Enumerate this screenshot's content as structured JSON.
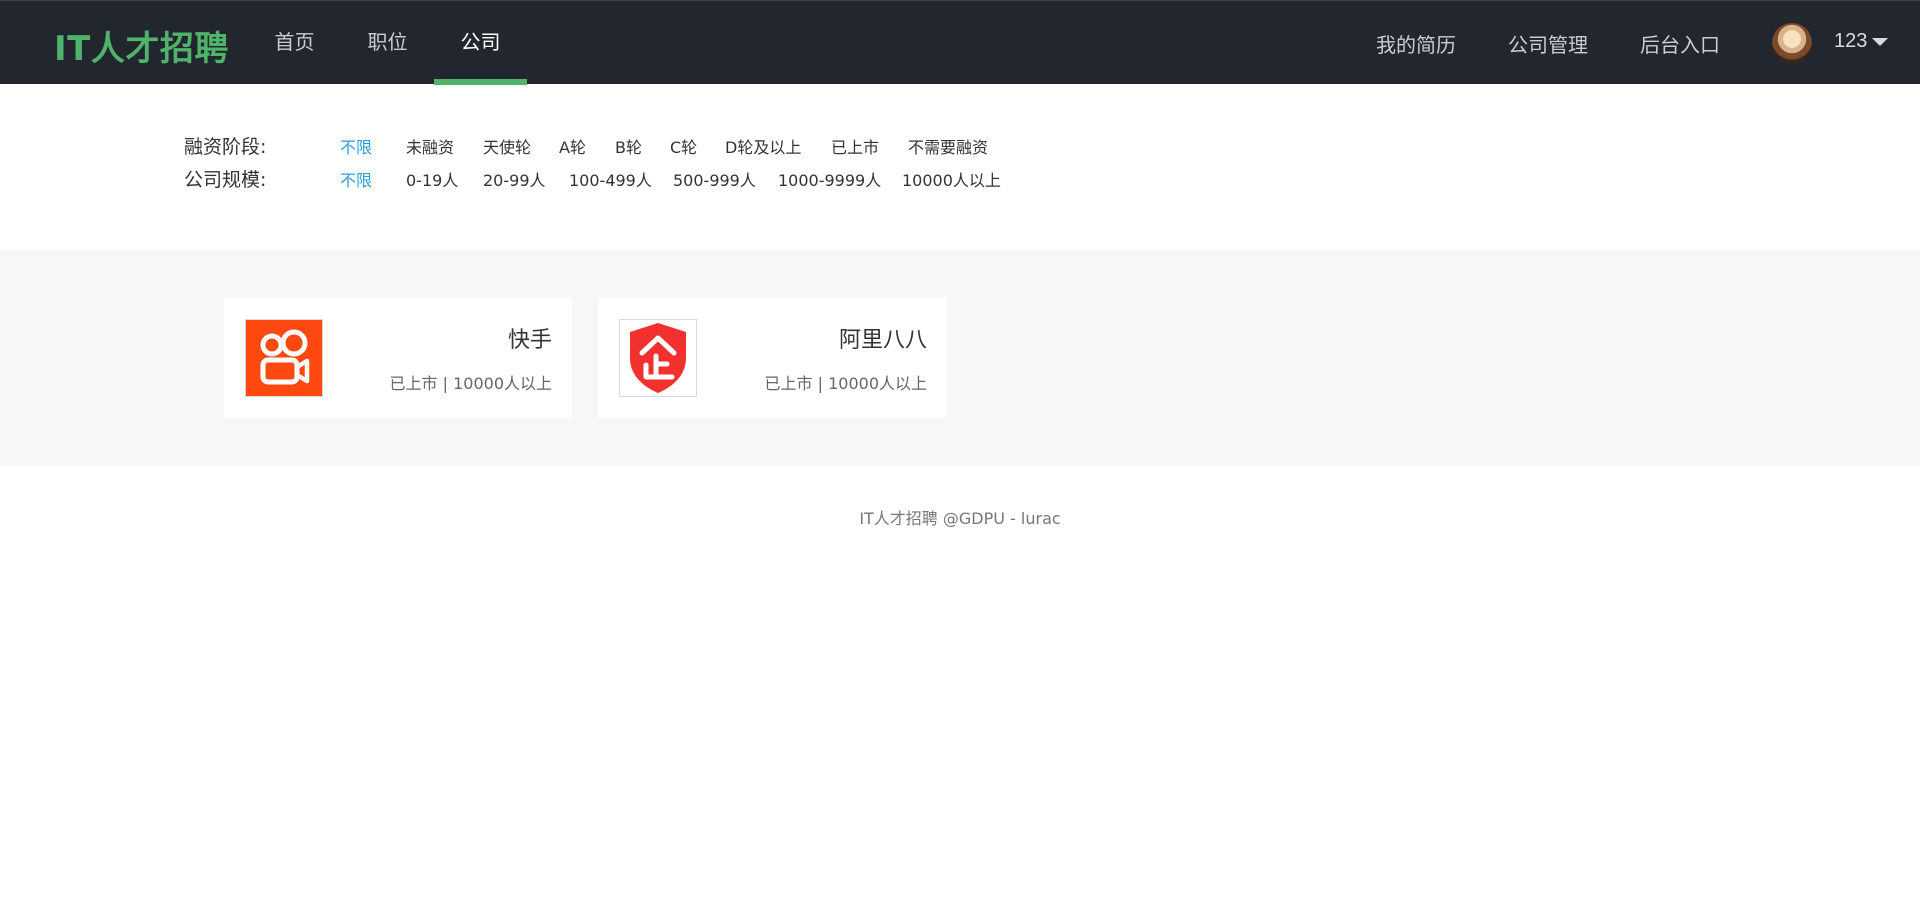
{
  "header": {
    "logo": "IT人才招聘",
    "nav": [
      {
        "label": "首页",
        "active": false
      },
      {
        "label": "职位",
        "active": false
      },
      {
        "label": "公司",
        "active": true
      }
    ],
    "right_links": [
      "我的简历",
      "公司管理",
      "后台入口"
    ],
    "user": {
      "name": "123",
      "avatar_icon": "user-avatar",
      "menu_icon": "caret-down-icon"
    },
    "accent_color": "#4fb369",
    "bg_color": "#22262f"
  },
  "filters": {
    "funding": {
      "label": "融资阶段:",
      "options": [
        "不限",
        "未融资",
        "天使轮",
        "A轮",
        "B轮",
        "C轮",
        "D轮及以上",
        "已上市",
        "不需要融资"
      ],
      "selected": "不限"
    },
    "size": {
      "label": "公司规模:",
      "options": [
        "不限",
        "0-19人",
        "20-99人",
        "100-499人",
        "500-999人",
        "1000-9999人",
        "10000人以上"
      ],
      "selected": "不限"
    },
    "active_color": "#2a9fd8"
  },
  "companies": [
    {
      "name": "快手",
      "meta": "已上市 | 10000人以上",
      "logo_icon": "kuaishou-logo-icon",
      "logo_color": "#fe4a10"
    },
    {
      "name": "阿里八八",
      "meta": "已上市 | 10000人以上",
      "logo_icon": "enterprise-shield-icon",
      "logo_color": "#f2302e"
    }
  ],
  "footer": {
    "text": "IT人才招聘 @GDPU - lurac"
  }
}
